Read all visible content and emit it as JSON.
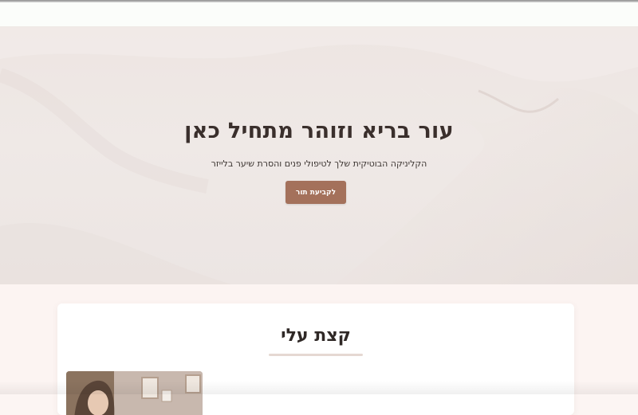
{
  "hero": {
    "title": "עור בריא וזוהר מתחיל כאן",
    "subtitle": "הקליניקה הבוטיקית שלך לטיפולי פנים והסרת שיער בלייזר",
    "cta_label": "לקביעת תור"
  },
  "about": {
    "title": "קצת עלי"
  },
  "colors": {
    "accent": "#a4715b",
    "hero_background": "#ede5e2",
    "page_background": "#fcf4f2",
    "text_dark": "#3a2f2c"
  }
}
